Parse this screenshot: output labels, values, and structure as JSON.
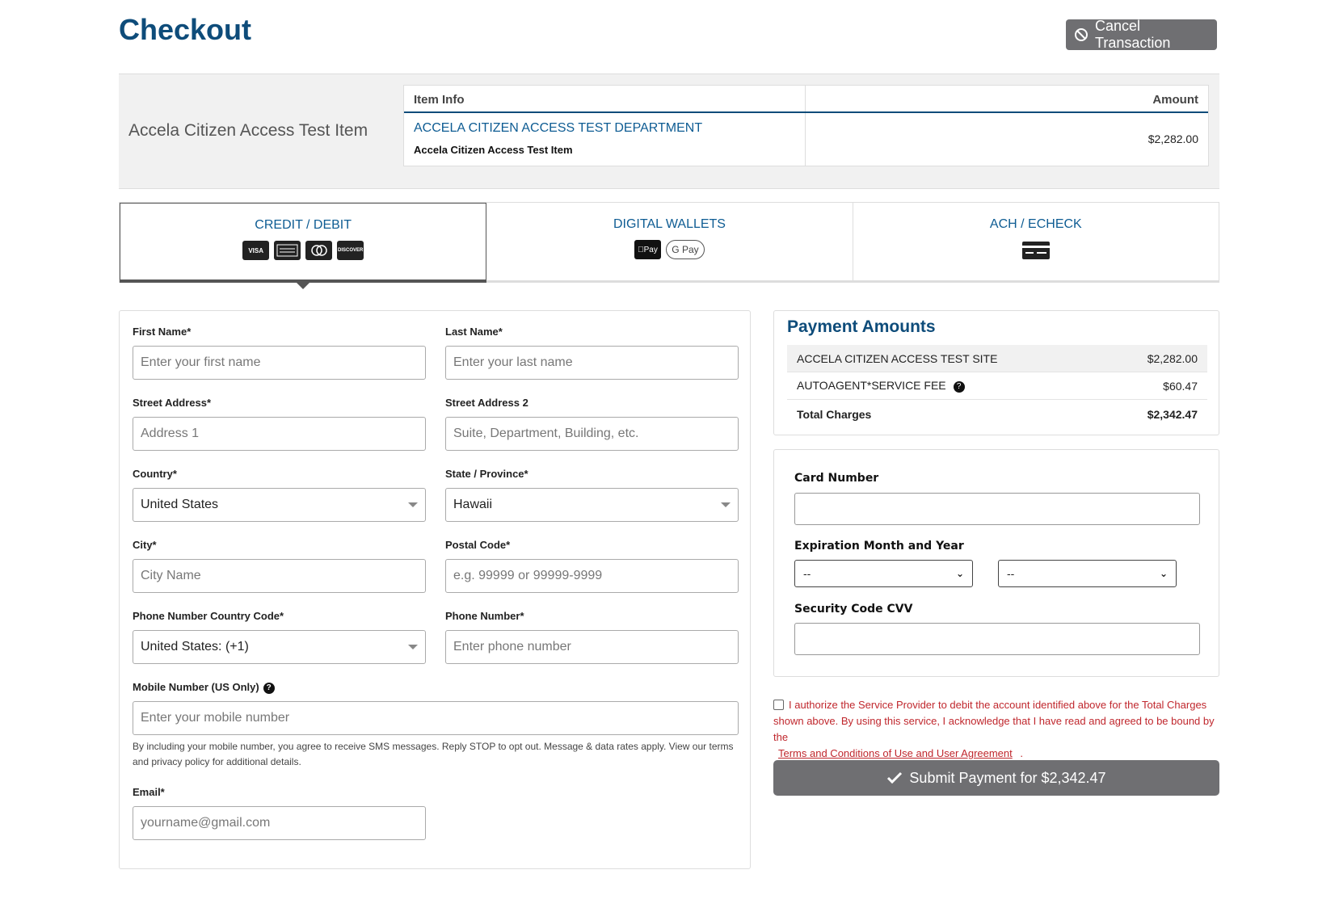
{
  "header": {
    "title": "Checkout",
    "cancel_label": "Cancel Transaction"
  },
  "summary": {
    "title": "Accela Citizen Access Test Item",
    "columns": [
      "Item Info",
      "Amount"
    ],
    "department": "ACCELA CITIZEN ACCESS TEST DEPARTMENT",
    "item_name": "Accela Citizen Access Test Item",
    "amount": "$2,282.00"
  },
  "tabs": [
    {
      "label": "CREDIT / DEBIT",
      "active": true,
      "icons": [
        "VISA",
        "AMEX",
        "MC",
        "DISCOVER"
      ]
    },
    {
      "label": "DIGITAL WALLETS",
      "active": false,
      "icons": [
        "Pay",
        "G Pay"
      ]
    },
    {
      "label": "ACH / ECHECK",
      "active": false,
      "icons": [
        "check-card-icon"
      ]
    }
  ],
  "form": {
    "first_name": {
      "label": "First Name*",
      "placeholder": "Enter your first name"
    },
    "last_name": {
      "label": "Last Name*",
      "placeholder": "Enter your last name"
    },
    "street1": {
      "label": "Street Address*",
      "placeholder": "Address 1"
    },
    "street2": {
      "label": "Street Address 2",
      "placeholder": "Suite, Department, Building, etc."
    },
    "country": {
      "label": "Country*",
      "value": "United States"
    },
    "state": {
      "label": "State / Province*",
      "value": "Hawaii"
    },
    "city": {
      "label": "City*",
      "placeholder": "City Name"
    },
    "postal": {
      "label": "Postal Code*",
      "placeholder": "e.g. 99999 or 99999-9999"
    },
    "phone_cc": {
      "label": "Phone Number Country Code*",
      "value": "United States: (+1)"
    },
    "phone": {
      "label": "Phone Number*",
      "placeholder": "Enter phone number"
    },
    "mobile": {
      "label": "Mobile Number (US Only)",
      "placeholder": "Enter your mobile number"
    },
    "sms_note": "By including your mobile number, you agree to receive SMS messages. Reply STOP to opt out. Message & data rates apply. View our terms and privacy policy for additional details.",
    "email": {
      "label": "Email*",
      "placeholder": "yourname@gmail.com"
    }
  },
  "amounts": {
    "title": "Payment Amounts",
    "rows": [
      {
        "label": "ACCELA CITIZEN ACCESS TEST SITE",
        "value": "$2,282.00"
      },
      {
        "label": "AUTOAGENT*SERVICE FEE",
        "value": "$60.47"
      }
    ],
    "total_label": "Total Charges",
    "total_value": "$2,342.47"
  },
  "card": {
    "number_label": "Card Number",
    "expiry_label": "Expiration Month and Year",
    "month_value": "--",
    "year_value": "--",
    "cvv_label": "Security Code CVV"
  },
  "authorize": {
    "text": "I authorize the Service Provider to debit the account identified above for the Total Charges shown above. By using this service, I acknowledge that I have read and agreed to be bound by the",
    "link": "Terms and Conditions of Use and User Agreement",
    "end": "."
  },
  "submit_label": "Submit Payment for $2,342.47",
  "colors": {
    "brand": "#0e4c7a",
    "link": "#0e5c93",
    "button": "#6f6f72",
    "error": "#c0272d"
  }
}
